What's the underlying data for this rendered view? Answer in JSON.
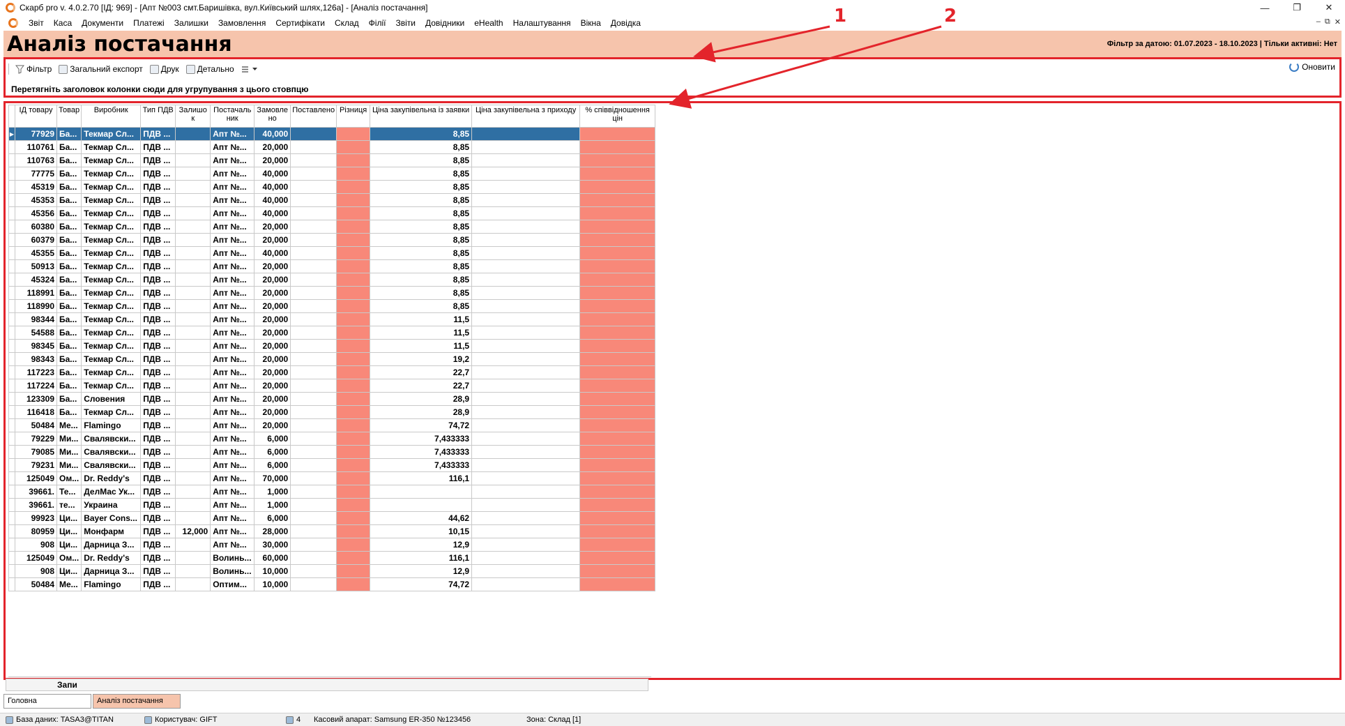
{
  "window": {
    "title": "Скарб pro v. 4.0.2.70 [ІД: 969] - [Апт №003 смт.Баришівка, вул.Київський шлях,126а] - [Аналіз постачання]",
    "minimize": "—",
    "maximize": "❐",
    "close": "✕"
  },
  "menu": {
    "items": [
      "Звіт",
      "Каса",
      "Документи",
      "Платежі",
      "Залишки",
      "Замовлення",
      "Сертифікати",
      "Склад",
      "Філії",
      "Звіти",
      "Довідники",
      "eHealth",
      "Налаштування",
      "Вікна",
      "Довідка"
    ],
    "mdi_min": "–",
    "mdi_restore": "⧉",
    "mdi_close": "✕"
  },
  "header": {
    "title": "Аналіз постачання",
    "filter_info": "Фільтр за датою: 01.07.2023 - 18.10.2023 | Тільки активні: Нет"
  },
  "toolbar": {
    "filter": "Фільтр",
    "export": "Загальний експорт",
    "print": "Друк",
    "detail": "Детально",
    "refresh": "Оновити",
    "group_hint": "Перетягніть заголовок колонки сюди для угрупування з цього стовпцю"
  },
  "annotations": {
    "label1": "1",
    "label2": "2"
  },
  "grid": {
    "columns": [
      "ІД товару",
      "Товар",
      "Виробник",
      "Тип ПДВ",
      "Залишо к",
      "Постачаль ник",
      "Замовле но",
      "Поставлено",
      "Різниця",
      "Ціна закупівельна із заявки",
      "Ціна закупівельна з приходу",
      "% співвідношення цін"
    ],
    "rows": [
      [
        "77929",
        "Ба...",
        "Текмар Сл...",
        "ПДВ ...",
        "",
        "Апт №...",
        "40,000",
        "",
        "",
        "8,85",
        "",
        ""
      ],
      [
        "110761",
        "Ба...",
        "Текмар Сл...",
        "ПДВ ...",
        "",
        "Апт №...",
        "20,000",
        "",
        "",
        "8,85",
        "",
        ""
      ],
      [
        "110763",
        "Ба...",
        "Текмар Сл...",
        "ПДВ ...",
        "",
        "Апт №...",
        "20,000",
        "",
        "",
        "8,85",
        "",
        ""
      ],
      [
        "77775",
        "Ба...",
        "Текмар Сл...",
        "ПДВ ...",
        "",
        "Апт №...",
        "40,000",
        "",
        "",
        "8,85",
        "",
        ""
      ],
      [
        "45319",
        "Ба...",
        "Текмар Сл...",
        "ПДВ ...",
        "",
        "Апт №...",
        "40,000",
        "",
        "",
        "8,85",
        "",
        ""
      ],
      [
        "45353",
        "Ба...",
        "Текмар Сл...",
        "ПДВ ...",
        "",
        "Апт №...",
        "40,000",
        "",
        "",
        "8,85",
        "",
        ""
      ],
      [
        "45356",
        "Ба...",
        "Текмар Сл...",
        "ПДВ ...",
        "",
        "Апт №...",
        "40,000",
        "",
        "",
        "8,85",
        "",
        ""
      ],
      [
        "60380",
        "Ба...",
        "Текмар Сл...",
        "ПДВ ...",
        "",
        "Апт №...",
        "20,000",
        "",
        "",
        "8,85",
        "",
        ""
      ],
      [
        "60379",
        "Ба...",
        "Текмар Сл...",
        "ПДВ ...",
        "",
        "Апт №...",
        "20,000",
        "",
        "",
        "8,85",
        "",
        ""
      ],
      [
        "45355",
        "Ба...",
        "Текмар Сл...",
        "ПДВ ...",
        "",
        "Апт №...",
        "40,000",
        "",
        "",
        "8,85",
        "",
        ""
      ],
      [
        "50913",
        "Ба...",
        "Текмар Сл...",
        "ПДВ ...",
        "",
        "Апт №...",
        "20,000",
        "",
        "",
        "8,85",
        "",
        ""
      ],
      [
        "45324",
        "Ба...",
        "Текмар Сл...",
        "ПДВ ...",
        "",
        "Апт №...",
        "20,000",
        "",
        "",
        "8,85",
        "",
        ""
      ],
      [
        "118991",
        "Ба...",
        "Текмар Сл...",
        "ПДВ ...",
        "",
        "Апт №...",
        "20,000",
        "",
        "",
        "8,85",
        "",
        ""
      ],
      [
        "118990",
        "Ба...",
        "Текмар Сл...",
        "ПДВ ...",
        "",
        "Апт №...",
        "20,000",
        "",
        "",
        "8,85",
        "",
        ""
      ],
      [
        "98344",
        "Ба...",
        "Текмар Сл...",
        "ПДВ ...",
        "",
        "Апт №...",
        "20,000",
        "",
        "",
        "11,5",
        "",
        ""
      ],
      [
        "54588",
        "Ба...",
        "Текмар Сл...",
        "ПДВ ...",
        "",
        "Апт №...",
        "20,000",
        "",
        "",
        "11,5",
        "",
        ""
      ],
      [
        "98345",
        "Ба...",
        "Текмар Сл...",
        "ПДВ ...",
        "",
        "Апт №...",
        "20,000",
        "",
        "",
        "11,5",
        "",
        ""
      ],
      [
        "98343",
        "Ба...",
        "Текмар Сл...",
        "ПДВ ...",
        "",
        "Апт №...",
        "20,000",
        "",
        "",
        "19,2",
        "",
        ""
      ],
      [
        "117223",
        "Ба...",
        "Текмар Сл...",
        "ПДВ ...",
        "",
        "Апт №...",
        "20,000",
        "",
        "",
        "22,7",
        "",
        ""
      ],
      [
        "117224",
        "Ба...",
        "Текмар Сл...",
        "ПДВ ...",
        "",
        "Апт №...",
        "20,000",
        "",
        "",
        "22,7",
        "",
        ""
      ],
      [
        "123309",
        "Ба...",
        "Словения",
        "ПДВ ...",
        "",
        "Апт №...",
        "20,000",
        "",
        "",
        "28,9",
        "",
        ""
      ],
      [
        "116418",
        "Ба...",
        "Текмар Сл...",
        "ПДВ ...",
        "",
        "Апт №...",
        "20,000",
        "",
        "",
        "28,9",
        "",
        ""
      ],
      [
        "50484",
        "Ме...",
        "Flamingo",
        "ПДВ ...",
        "",
        "Апт №...",
        "20,000",
        "",
        "",
        "74,72",
        "",
        ""
      ],
      [
        "79229",
        "Ми...",
        "Свалявски...",
        "ПДВ ...",
        "",
        "Апт №...",
        "6,000",
        "",
        "",
        "7,433333",
        "",
        ""
      ],
      [
        "79085",
        "Ми...",
        "Свалявски...",
        "ПДВ ...",
        "",
        "Апт №...",
        "6,000",
        "",
        "",
        "7,433333",
        "",
        ""
      ],
      [
        "79231",
        "Ми...",
        "Свалявски...",
        "ПДВ ...",
        "",
        "Апт №...",
        "6,000",
        "",
        "",
        "7,433333",
        "",
        ""
      ],
      [
        "125049",
        "Ом...",
        "Dr. Reddy's",
        "ПДВ ...",
        "",
        "Апт №...",
        "70,000",
        "",
        "",
        "116,1",
        "",
        ""
      ],
      [
        "39661.",
        "Те...",
        "ДелМас Ук...",
        "ПДВ ...",
        "",
        "Апт №...",
        "1,000",
        "",
        "",
        "",
        "",
        ""
      ],
      [
        "39661.",
        "те...",
        "Украина",
        "ПДВ ...",
        "",
        "Апт №...",
        "1,000",
        "",
        "",
        "",
        "",
        ""
      ],
      [
        "99923",
        "Ци...",
        "Bayer Cons...",
        "ПДВ ...",
        "",
        "Апт №...",
        "6,000",
        "",
        "",
        "44,62",
        "",
        ""
      ],
      [
        "80959",
        "Ци...",
        "Монфарм",
        "ПДВ ...",
        "12,000",
        "Апт №...",
        "28,000",
        "",
        "",
        "10,15",
        "",
        ""
      ],
      [
        "908",
        "Ци...",
        "Дарница З...",
        "ПДВ ...",
        "",
        "Апт №...",
        "30,000",
        "",
        "",
        "12,9",
        "",
        ""
      ],
      [
        "125049",
        "Ом...",
        "Dr. Reddy's",
        "ПДВ ...",
        "",
        "Волинь...",
        "60,000",
        "",
        "",
        "116,1",
        "",
        ""
      ],
      [
        "908",
        "Ци...",
        "Дарница З...",
        "ПДВ ...",
        "",
        "Волинь...",
        "10,000",
        "",
        "",
        "12,9",
        "",
        ""
      ],
      [
        "50484",
        "Ме...",
        "Flamingo",
        "ПДВ ...",
        "",
        "Оптим...",
        "10,000",
        "",
        "",
        "74,72",
        "",
        ""
      ]
    ],
    "selected_row": 0,
    "footer_label": "Запи"
  },
  "tabs": [
    {
      "label": "Головна",
      "active": false
    },
    {
      "label": "Аналіз постачання",
      "active": true
    }
  ],
  "status": {
    "database": "База даних: TASA3@TITAN",
    "user": "Користувач: GIFT",
    "count": "4",
    "register": "Касовий апарат: Samsung ER-350 №123456",
    "zone": "Зона: Склад [1]"
  },
  "colors": {
    "header_bg": "#f6c4ac",
    "highlight_red": "#f88879",
    "selected_row": "#2f6fa3",
    "annotation_red": "#e3242b"
  }
}
